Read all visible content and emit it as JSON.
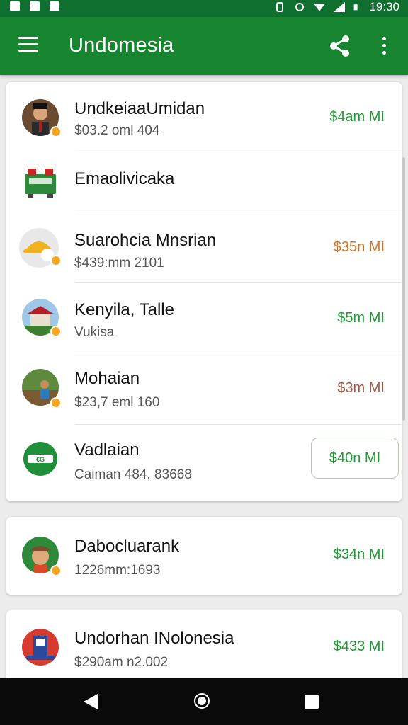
{
  "status_bar": {
    "time": "19:30"
  },
  "app_bar": {
    "title": "Undomesia"
  },
  "list": [
    {
      "name": "UndkeiaaUmidan",
      "subtitle": "$03.2 oml 404",
      "amount": "$4am MI",
      "amount_color": "#1f9a34",
      "avatar": "man-portrait-icon"
    },
    {
      "name": "Emaolivicaka",
      "subtitle": "",
      "amount": "",
      "amount_color": "",
      "avatar": "cash-register-icon"
    },
    {
      "name": "Suarohcia Mnsrian",
      "subtitle": "$439:mm 2101",
      "amount": "$35n MI",
      "amount_color": "#d0762a",
      "avatar": "hardhat-icon"
    },
    {
      "name": "Kenyila, Talle",
      "subtitle": "Vukisa",
      "amount": "$5m MI",
      "amount_color": "#1f9a34",
      "avatar": "temple-icon"
    },
    {
      "name": "Mohaian",
      "subtitle": "$23,7 eml 160",
      "amount": "$3m MI",
      "amount_color": "#9a5a45",
      "avatar": "farmer-icon"
    },
    {
      "name": "Vadlaian",
      "subtitle": "Caiman 484, 83668",
      "amount": "$40n MI",
      "amount_color": "#1f9a34",
      "avatar": "green-logo-icon"
    }
  ],
  "cards": [
    {
      "name": "Dabocluarank",
      "subtitle": "1226mm:1693",
      "amount": "$34n MI",
      "avatar": "man-hat-icon"
    },
    {
      "name": "Undorhan INolonesia",
      "subtitle": "$290am n2.002",
      "amount": "$433 MI",
      "avatar": "emblem-icon"
    }
  ]
}
